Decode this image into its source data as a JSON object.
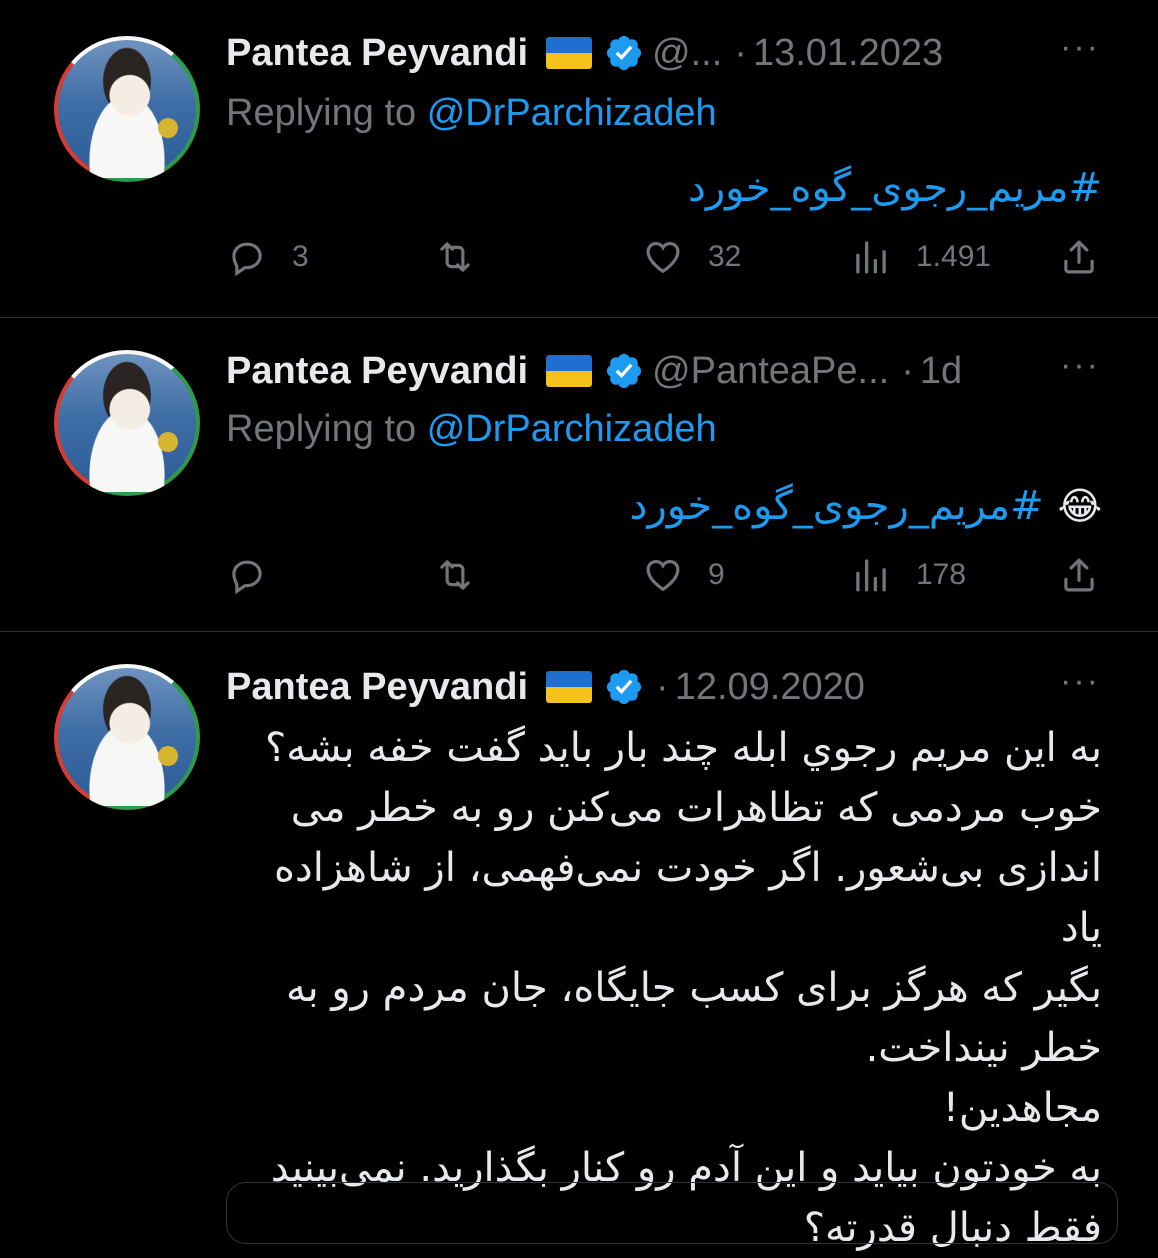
{
  "tweets": [
    {
      "author_name": "Pantea Peyvandi",
      "handle": "@...",
      "date": "13.01.2023",
      "more_label": "···",
      "replying_prefix": "Replying to",
      "replying_to": "@DrParchizadeh",
      "hashtag": "#مریم_رجوی_گوه_خورد",
      "emoji": "",
      "counts": {
        "replies": "3",
        "retweets": "",
        "likes": "32",
        "views": "1.491"
      }
    },
    {
      "author_name": "Pantea Peyvandi",
      "handle": "@PanteaPe...",
      "date": "1d",
      "more_label": "···",
      "replying_prefix": "Replying to",
      "replying_to": "@DrParchizadeh",
      "hashtag": "#مریم_رجوی_گوه_خورد",
      "emoji": "😂",
      "counts": {
        "replies": "",
        "retweets": "",
        "likes": "9",
        "views": "178"
      }
    },
    {
      "author_name": "Pantea Peyvandi",
      "handle": "",
      "date": "12.09.2020",
      "more_label": "···",
      "body_lines": [
        "به این مریم رجوي ابله چند بار باید گفت خفه بشه؟",
        "خوب مردمی که تظاهرات می‌کنن رو به خطر می",
        "اندازی بی‌شعور. اگر خودت نمی‌فهمی، از شاهزاده یاد",
        "بگیر  که هرگز برای کسب جایگاه، جان مردم رو به",
        "خطر نینداخت.",
        "مجاهدین!",
        "به خودتون بیاید و این آدم رو کنار بگذارید. نمی‌بینید",
        "فقط دنبال قدرته؟"
      ]
    }
  ],
  "icons": {
    "verified": "verified-badge-icon",
    "flag": "ukraine-flag-icon",
    "reply": "reply-icon",
    "retweet": "retweet-icon",
    "like": "heart-icon",
    "views": "views-icon",
    "share": "share-icon"
  },
  "colors": {
    "background": "#000000",
    "text": "#e7e9ea",
    "muted": "#71767b",
    "accent": "#1d9bf0",
    "divider": "#2f3336"
  }
}
